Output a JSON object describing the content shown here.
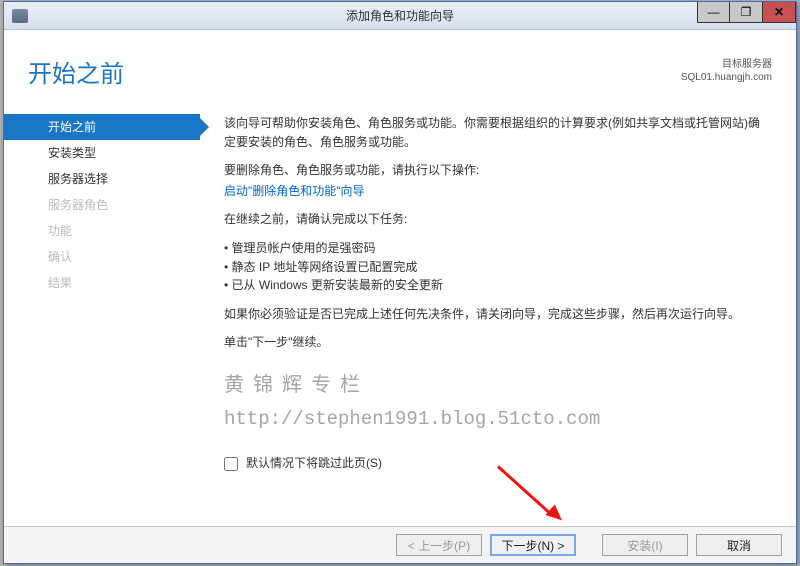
{
  "window": {
    "title": "添加角色和功能向导",
    "min": "—",
    "max": "❐",
    "close": "✕"
  },
  "header": {
    "page_title": "开始之前",
    "target_label": "目标服务器",
    "target_value": "SQL01.huangjh.com"
  },
  "sidebar": {
    "items": [
      {
        "label": "开始之前",
        "state": "active"
      },
      {
        "label": "安装类型",
        "state": "enabled"
      },
      {
        "label": "服务器选择",
        "state": "enabled"
      },
      {
        "label": "服务器角色",
        "state": "disabled"
      },
      {
        "label": "功能",
        "state": "disabled"
      },
      {
        "label": "确认",
        "state": "disabled"
      },
      {
        "label": "结果",
        "state": "disabled"
      }
    ]
  },
  "main": {
    "intro": "该向导可帮助你安装角色、角色服务或功能。你需要根据组织的计算要求(例如共享文档或托管网站)确定要安装的角色、角色服务或功能。",
    "remove_label": "要删除角色、角色服务或功能，请执行以下操作:",
    "remove_link": "启动\"删除角色和功能\"向导",
    "pre_label": "在继续之前，请确认完成以下任务:",
    "bullets": [
      "管理员帐户使用的是强密码",
      "静态 IP 地址等网络设置已配置完成",
      "已从 Windows 更新安装最新的安全更新"
    ],
    "verify": "如果你必须验证是否已完成上述任何先决条件，请关闭向导，完成这些步骤，然后再次运行向导。",
    "next_hint": "单击\"下一步\"继续。",
    "watermark1": "黄 锦 辉 专 栏",
    "watermark2": "http://stephen1991.blog.51cto.com",
    "skip_label": "默认情况下将跳过此页(S)"
  },
  "footer": {
    "prev": "< 上一步(P)",
    "next": "下一步(N) >",
    "install": "安装(I)",
    "cancel": "取消"
  }
}
